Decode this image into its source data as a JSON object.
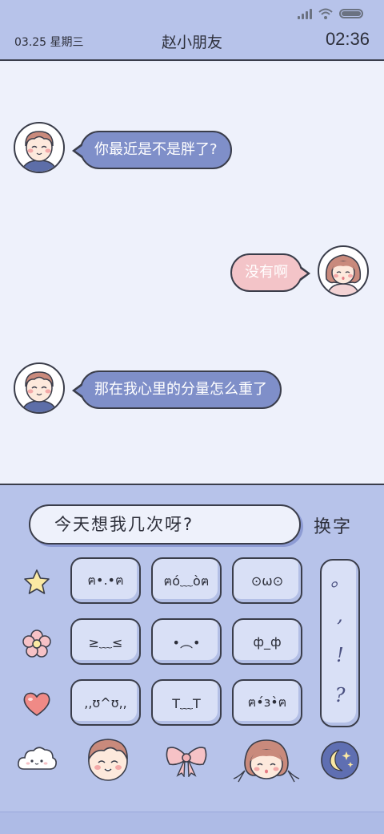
{
  "status_bar": {
    "icons": [
      "signal-icon",
      "wifi-icon",
      "battery-icon"
    ]
  },
  "header": {
    "date": "03.25 星期三",
    "title": "赵小朋友",
    "time": "02:36"
  },
  "messages": [
    {
      "side": "left",
      "sender": "boy",
      "text": "你最近是不是胖了?"
    },
    {
      "side": "right",
      "sender": "girl",
      "text": "没有啊"
    },
    {
      "side": "left",
      "sender": "boy",
      "text": "那在我心里的分量怎么重了"
    }
  ],
  "keyboard": {
    "input_text": "今天想我几次呀?",
    "switch_label": "换字",
    "kaomoji_keys": [
      [
        "ฅ•.•ฅ",
        "ฅó﹏òฅ",
        "⊙ω⊙"
      ],
      [
        "≥﹏≤",
        "•︵•",
        "ф_ф"
      ],
      [
        ",,ʊ^ʊ,,",
        "T﹏T",
        "ฅ•́з•̀ฅ"
      ]
    ],
    "punctuation": [
      "。",
      ",",
      "!",
      "?"
    ],
    "side_icons": [
      "star-icon",
      "flower-icon",
      "heart-icon"
    ],
    "bottom_icons": [
      "cloud-icon",
      "boy-face-icon",
      "bow-icon",
      "girl-face-icon",
      "moon-icon"
    ]
  },
  "colors": {
    "panel": "#b7c3ea",
    "chat_bg": "#eef1fb",
    "bubble_blue": "#7f8fc9",
    "bubble_pink": "#f3c4c8",
    "outline": "#3a3d4a"
  }
}
